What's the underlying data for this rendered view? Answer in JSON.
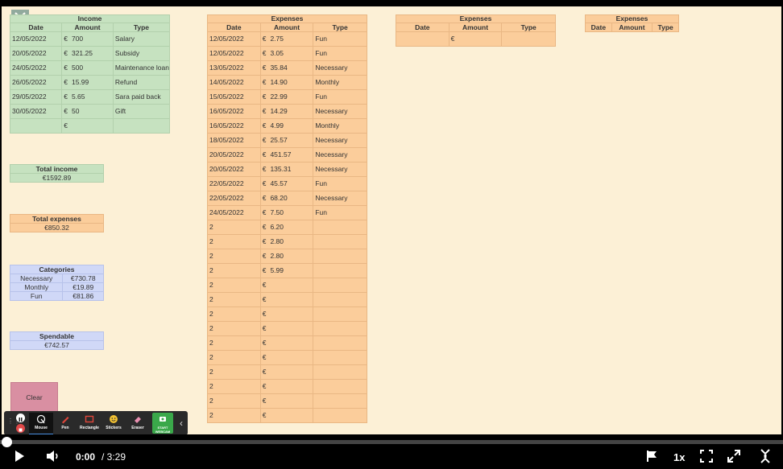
{
  "income": {
    "title": "Income",
    "columns": [
      "Date",
      "Amount",
      "Type"
    ],
    "rows": [
      {
        "date": "12/05/2022",
        "currency": "€",
        "amount": "700",
        "type": "Salary"
      },
      {
        "date": "20/05/2022",
        "currency": "€",
        "amount": "321.25",
        "type": "Subsidy"
      },
      {
        "date": "24/05/2022",
        "currency": "€",
        "amount": "500",
        "type": "Maintenance loan"
      },
      {
        "date": "26/05/2022",
        "currency": "€",
        "amount": "15.99",
        "type": "Refund"
      },
      {
        "date": "29/05/2022",
        "currency": "€",
        "amount": "5.65",
        "type": "Sara paid back"
      },
      {
        "date": "30/05/2022",
        "currency": "€",
        "amount": "50",
        "type": "Gift"
      },
      {
        "date": "",
        "currency": "€",
        "amount": "",
        "type": ""
      }
    ]
  },
  "expenses_main": {
    "title": "Expenses",
    "columns": [
      "Date",
      "Amount",
      "Type"
    ],
    "rows": [
      {
        "date": "12/05/2022",
        "currency": "€",
        "amount": "2.75",
        "type": "Fun"
      },
      {
        "date": "12/05/2022",
        "currency": "€",
        "amount": "3.05",
        "type": "Fun"
      },
      {
        "date": "13/05/2022",
        "currency": "€",
        "amount": "35.84",
        "type": "Necessary"
      },
      {
        "date": "14/05/2022",
        "currency": "€",
        "amount": "14.90",
        "type": "Monthly"
      },
      {
        "date": "15/05/2022",
        "currency": "€",
        "amount": "22.99",
        "type": "Fun"
      },
      {
        "date": "16/05/2022",
        "currency": "€",
        "amount": "14.29",
        "type": "Necessary"
      },
      {
        "date": "16/05/2022",
        "currency": "€",
        "amount": "4.99",
        "type": "Monthly"
      },
      {
        "date": "18/05/2022",
        "currency": "€",
        "amount": "25.57",
        "type": "Necessary"
      },
      {
        "date": "20/05/2022",
        "currency": "€",
        "amount": "451.57",
        "type": "Necessary"
      },
      {
        "date": "20/05/2022",
        "currency": "€",
        "amount": "135.31",
        "type": "Necessary"
      },
      {
        "date": "22/05/2022",
        "currency": "€",
        "amount": "45.57",
        "type": "Fun"
      },
      {
        "date": "22/05/2022",
        "currency": "€",
        "amount": "68.20",
        "type": "Necessary"
      },
      {
        "date": "24/05/2022",
        "currency": "€",
        "amount": "7.50",
        "type": "Fun"
      },
      {
        "date": "2",
        "currency": "€",
        "amount": "6.20",
        "type": ""
      },
      {
        "date": "2",
        "currency": "€",
        "amount": "2.80",
        "type": ""
      },
      {
        "date": "2",
        "currency": "€",
        "amount": "2.80",
        "type": ""
      },
      {
        "date": "2",
        "currency": "€",
        "amount": "5.99",
        "type": ""
      },
      {
        "date": "2",
        "currency": "€",
        "amount": "",
        "type": ""
      },
      {
        "date": "2",
        "currency": "€",
        "amount": "",
        "type": ""
      },
      {
        "date": "2",
        "currency": "€",
        "amount": "",
        "type": ""
      },
      {
        "date": "2",
        "currency": "€",
        "amount": "",
        "type": ""
      },
      {
        "date": "2",
        "currency": "€",
        "amount": "",
        "type": ""
      },
      {
        "date": "2",
        "currency": "€",
        "amount": "",
        "type": ""
      },
      {
        "date": "2",
        "currency": "€",
        "amount": "",
        "type": ""
      },
      {
        "date": "2",
        "currency": "€",
        "amount": "",
        "type": ""
      },
      {
        "date": "2",
        "currency": "€",
        "amount": "",
        "type": ""
      },
      {
        "date": "2",
        "currency": "€",
        "amount": "",
        "type": ""
      }
    ]
  },
  "expenses_second": {
    "title": "Expenses",
    "columns": [
      "Date",
      "Amount",
      "Type"
    ],
    "rows": [
      {
        "date": "",
        "currency": "€",
        "amount": "",
        "type": ""
      }
    ]
  },
  "expenses_third": {
    "title": "Expenses",
    "columns": [
      "Date",
      "Amount",
      "Type"
    ]
  },
  "total_income": {
    "title": "Total income",
    "value": "€1592.89"
  },
  "total_expenses": {
    "title": "Total expenses",
    "value": "€850.32"
  },
  "categories": {
    "title": "Categories",
    "rows": [
      {
        "name": "Necessary",
        "value": "€730.78"
      },
      {
        "name": "Monthly",
        "value": "€19.89"
      },
      {
        "name": "Fun",
        "value": "€81.86"
      }
    ]
  },
  "spendable": {
    "title": "Spendable",
    "value": "€742.57"
  },
  "clear_label": "Clear",
  "toolbar": {
    "tools": [
      {
        "label": "Mouse",
        "icon": "mouse-cursor-icon"
      },
      {
        "label": "Pen",
        "icon": "pen-icon"
      },
      {
        "label": "Rectangle",
        "icon": "rectangle-icon"
      },
      {
        "label": "Stickers",
        "icon": "sticker-smiley-icon"
      },
      {
        "label": "Eraser",
        "icon": "eraser-icon"
      },
      {
        "label": "START WEBCAM",
        "icon": "webcam-icon"
      }
    ]
  },
  "player": {
    "current_time": "0:00",
    "duration": "/ 3:29",
    "speed": "1x",
    "progress": 0.0
  },
  "colors": {
    "background": "#fcf0d6",
    "income": "#c6e2c0",
    "expenses": "#fbcd9b",
    "summary_blue": "#d0d8f7",
    "clear_button": "#d98fa2",
    "webcam_button": "#3aa84a"
  }
}
